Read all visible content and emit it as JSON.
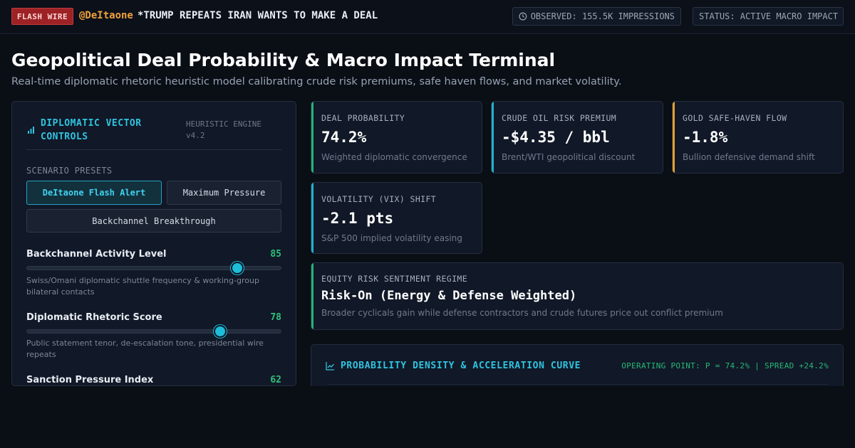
{
  "topbar": {
    "flash_label": "FLASH WIRE",
    "handle": "@DeItaone",
    "headline": "*TRUMP REPEATS IRAN WANTS TO MAKE A DEAL",
    "observed": "OBSERVED: 155.5K IMPRESSIONS",
    "status": "STATUS: ACTIVE MACRO IMPACT"
  },
  "page": {
    "title": "Geopolitical Deal Probability & Macro Impact Terminal",
    "subtitle": "Real-time diplomatic rhetoric heuristic model calibrating crude risk premiums, safe haven flows, and market volatility."
  },
  "controls": {
    "title": "DIPLOMATIC VECTOR CONTROLS",
    "engine": "HEURISTIC ENGINE v4.2",
    "presets_label": "SCENARIO PRESETS",
    "presets": [
      {
        "label": "DeItaone Flash Alert",
        "active": true
      },
      {
        "label": "Maximum Pressure",
        "active": false
      },
      {
        "label": "Backchannel Breakthrough",
        "active": false
      }
    ],
    "sliders": [
      {
        "label": "Backchannel Activity Level",
        "value": "85",
        "level": 0.83,
        "desc": "Swiss/Omani diplomatic shuttle frequency & working-group bilateral contacts"
      },
      {
        "label": "Diplomatic Rhetoric Score",
        "value": "78",
        "level": 0.76,
        "desc": "Public statement tenor, de-escalation tone, presidential wire repeats"
      },
      {
        "label": "Sanction Pressure Index",
        "value": "62",
        "level": 0.62,
        "desc": ""
      }
    ]
  },
  "metrics": [
    {
      "label": "DEAL PROBABILITY",
      "value": "74.2%",
      "desc": "Weighted diplomatic convergence",
      "accent": "#25b27a"
    },
    {
      "label": "CRUDE OIL RISK PREMIUM",
      "value": "-$4.35 / bbl",
      "desc": "Brent/WTI geopolitical discount",
      "accent": "#1fb3cf"
    },
    {
      "label": "GOLD SAFE-HAVEN FLOW",
      "value": "-1.8%",
      "desc": "Bullion defensive demand shift",
      "accent": "#e2a12d"
    },
    {
      "label": "VOLATILITY (VIX) SHIFT",
      "value": "-2.1 pts",
      "desc": "S&P 500 implied volatility easing",
      "accent": "#1fb3cf"
    }
  ],
  "regime": {
    "label": "EQUITY RISK SENTIMENT REGIME",
    "value": "Risk-On (Energy & Defense Weighted)",
    "desc": "Broader cyclicals gain while defense contractors and crude futures price out conflict premium",
    "accent": "#25b27a"
  },
  "chart_panel": {
    "title": "PROBABILITY DENSITY & ACCELERATION CURVE",
    "operating_point": "OPERATING POINT: P = 74.2% | SPREAD +24.2%"
  },
  "icons": {
    "clock": "clock-icon",
    "signal": "signal-bars-icon",
    "chart": "line-chart-icon"
  }
}
